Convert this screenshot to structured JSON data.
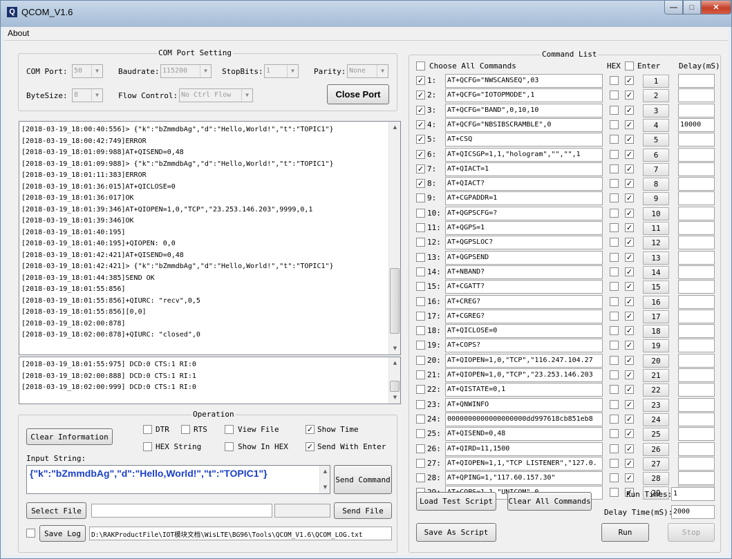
{
  "window": {
    "title": "QCOM_V1.6"
  },
  "menu": {
    "about": "About"
  },
  "com_port": {
    "group_title": "COM Port Setting",
    "com_port_label": "COM Port:",
    "com_port_value": "50",
    "baudrate_label": "Baudrate:",
    "baudrate_value": "115200",
    "stopbits_label": "StopBits:",
    "stopbits_value": "1",
    "parity_label": "Parity:",
    "parity_value": "None",
    "bytesize_label": "ByteSize:",
    "bytesize_value": "8",
    "flow_label": "Flow Control:",
    "flow_value": "No Ctrl Flow",
    "close_port": "Close Port"
  },
  "log": {
    "lines": [
      "[2018-03-19_18:00:40:556]> {\"k\":\"bZmmdbAg\",\"d\":\"Hello,World!\",\"t\":\"TOPIC1\"}",
      "[2018-03-19_18:00:42:749]ERROR",
      "[2018-03-19_18:01:09:988]AT+QISEND=0,48",
      "[2018-03-19_18:01:09:988]> {\"k\":\"bZmmdbAg\",\"d\":\"Hello,World!\",\"t\":\"TOPIC1\"}",
      "[2018-03-19_18:01:11:383]ERROR",
      "[2018-03-19_18:01:36:015]AT+QICLOSE=0",
      "[2018-03-19_18:01:36:017]OK",
      "[2018-03-19_18:01:39:346]AT+QIOPEN=1,0,\"TCP\",\"23.253.146.203\",9999,0,1",
      "[2018-03-19_18:01:39:346]OK",
      "[2018-03-19_18:01:40:195]",
      "[2018-03-19_18:01:40:195]+QIOPEN: 0,0",
      "[2018-03-19_18:01:42:421]AT+QISEND=0,48",
      "[2018-03-19_18:01:42:421]> {\"k\":\"bZmmdbAg\",\"d\":\"Hello,World!\",\"t\":\"TOPIC1\"}",
      "[2018-03-19_18:01:44:385]SEND OK",
      "[2018-03-19_18:01:55:856]",
      "[2018-03-19_18:01:55:856]+QIURC: \"recv\",0,5",
      "[2018-03-19_18:01:55:856][0,0]",
      "[2018-03-19_18:02:00:878]",
      "[2018-03-19_18:02:00:878]+QIURC: \"closed\",0"
    ]
  },
  "status_log": {
    "lines": [
      "[2018-03-19_18:01:55:975] DCD:0  CTS:1  RI:0",
      "[2018-03-19_18:02:00:888] DCD:0  CTS:1  RI:1",
      "[2018-03-19_18:02:00:999] DCD:0  CTS:1  RI:0"
    ]
  },
  "operation": {
    "group_title": "Operation",
    "clear_info": "Clear Information",
    "dtr": "DTR",
    "rts": "RTS",
    "view_file": "View File",
    "show_time": "Show Time",
    "hex_string": "HEX String",
    "show_in_hex": "Show In HEX",
    "send_with_enter": "Send With Enter",
    "input_label": "Input String:",
    "input_value": "{\"k\":\"bZmmdbAg\",\"d\":\"Hello,World!\",\"t\":\"TOPIC1\"}",
    "send_command": "Send Command",
    "select_file": "Select File",
    "send_file": "Send File",
    "save_log": "Save Log",
    "log_path": "D:\\RAKProductFile\\IOT模块文档\\WisLTE\\BG96\\Tools\\QCOM_V1.6\\QCOM_LOG.txt"
  },
  "command_list": {
    "group_title": "Command List",
    "choose_all": "Choose All Commands",
    "hex_header": "HEX",
    "enter_header": "Enter",
    "delay_header": "Delay(mS)",
    "commands": [
      {
        "num": "1:",
        "checked": true,
        "cmd": "AT+QCFG=\"NWSCANSEQ\",03",
        "delay": ""
      },
      {
        "num": "2:",
        "checked": true,
        "cmd": "AT+QCFG=\"IOTOPMODE\",1",
        "delay": ""
      },
      {
        "num": "3:",
        "checked": true,
        "cmd": "AT+QCFG=\"BAND\",0,10,10",
        "delay": ""
      },
      {
        "num": "4:",
        "checked": true,
        "cmd": "AT+QCFG=\"NBSIBSCRAMBLE\",0",
        "delay": "10000"
      },
      {
        "num": "5:",
        "checked": true,
        "cmd": "AT+CSQ",
        "delay": ""
      },
      {
        "num": "6:",
        "checked": true,
        "cmd": "AT+QICSGP=1,1,\"hologram\",\"\",\"\",1",
        "delay": ""
      },
      {
        "num": "7:",
        "checked": true,
        "cmd": "AT+QIACT=1",
        "delay": ""
      },
      {
        "num": "8:",
        "checked": true,
        "cmd": "AT+QIACT?",
        "delay": ""
      },
      {
        "num": "9:",
        "checked": false,
        "cmd": "AT+CGPADDR=1",
        "delay": ""
      },
      {
        "num": "10:",
        "checked": false,
        "cmd": "AT+QGPSCFG=?",
        "delay": ""
      },
      {
        "num": "11:",
        "checked": false,
        "cmd": "AT+QGPS=1",
        "delay": ""
      },
      {
        "num": "12:",
        "checked": false,
        "cmd": "AT+QGPSLOC?",
        "delay": ""
      },
      {
        "num": "13:",
        "checked": false,
        "cmd": "AT+QGPSEND",
        "delay": ""
      },
      {
        "num": "14:",
        "checked": false,
        "cmd": "AT+NBAND?",
        "delay": ""
      },
      {
        "num": "15:",
        "checked": false,
        "cmd": "AT+CGATT?",
        "delay": ""
      },
      {
        "num": "16:",
        "checked": false,
        "cmd": "AT+CREG?",
        "delay": ""
      },
      {
        "num": "17:",
        "checked": false,
        "cmd": "AT+CGREG?",
        "delay": ""
      },
      {
        "num": "18:",
        "checked": false,
        "cmd": "AT+QICLOSE=0",
        "delay": ""
      },
      {
        "num": "19:",
        "checked": false,
        "cmd": "AT+COPS?",
        "delay": ""
      },
      {
        "num": "20:",
        "checked": false,
        "cmd": "AT+QIOPEN=1,0,\"TCP\",\"116.247.104.27",
        "delay": ""
      },
      {
        "num": "21:",
        "checked": false,
        "cmd": "AT+QIOPEN=1,0,\"TCP\",\"23.253.146.203",
        "delay": ""
      },
      {
        "num": "22:",
        "checked": false,
        "cmd": "AT+QISTATE=0,1",
        "delay": ""
      },
      {
        "num": "23:",
        "checked": false,
        "cmd": "AT+QNWINFO",
        "delay": ""
      },
      {
        "num": "24:",
        "checked": false,
        "cmd": "0000000000000000000dd997618cb851eb8",
        "delay": ""
      },
      {
        "num": "25:",
        "checked": false,
        "cmd": "AT+QISEND=0,48",
        "delay": ""
      },
      {
        "num": "26:",
        "checked": false,
        "cmd": "AT+QIRD=11,1500",
        "delay": ""
      },
      {
        "num": "27:",
        "checked": false,
        "cmd": "AT+QIOPEN=1,1,\"TCP LISTENER\",\"127.0.",
        "delay": ""
      },
      {
        "num": "28:",
        "checked": false,
        "cmd": "AT+QPING=1,\"117.60.157.30\"",
        "delay": ""
      },
      {
        "num": "29:",
        "checked": false,
        "cmd": "AT+COPS=1,1,\"UNICOM\",0",
        "delay": ""
      }
    ],
    "load_script": "Load Test Script",
    "clear_all": "Clear All Commands",
    "save_script": "Save As Script",
    "run_times_label": "Run Times:",
    "run_times_value": "1",
    "delay_time_label": "Delay Time(mS):",
    "delay_time_value": "2000",
    "run": "Run",
    "stop": "Stop"
  }
}
